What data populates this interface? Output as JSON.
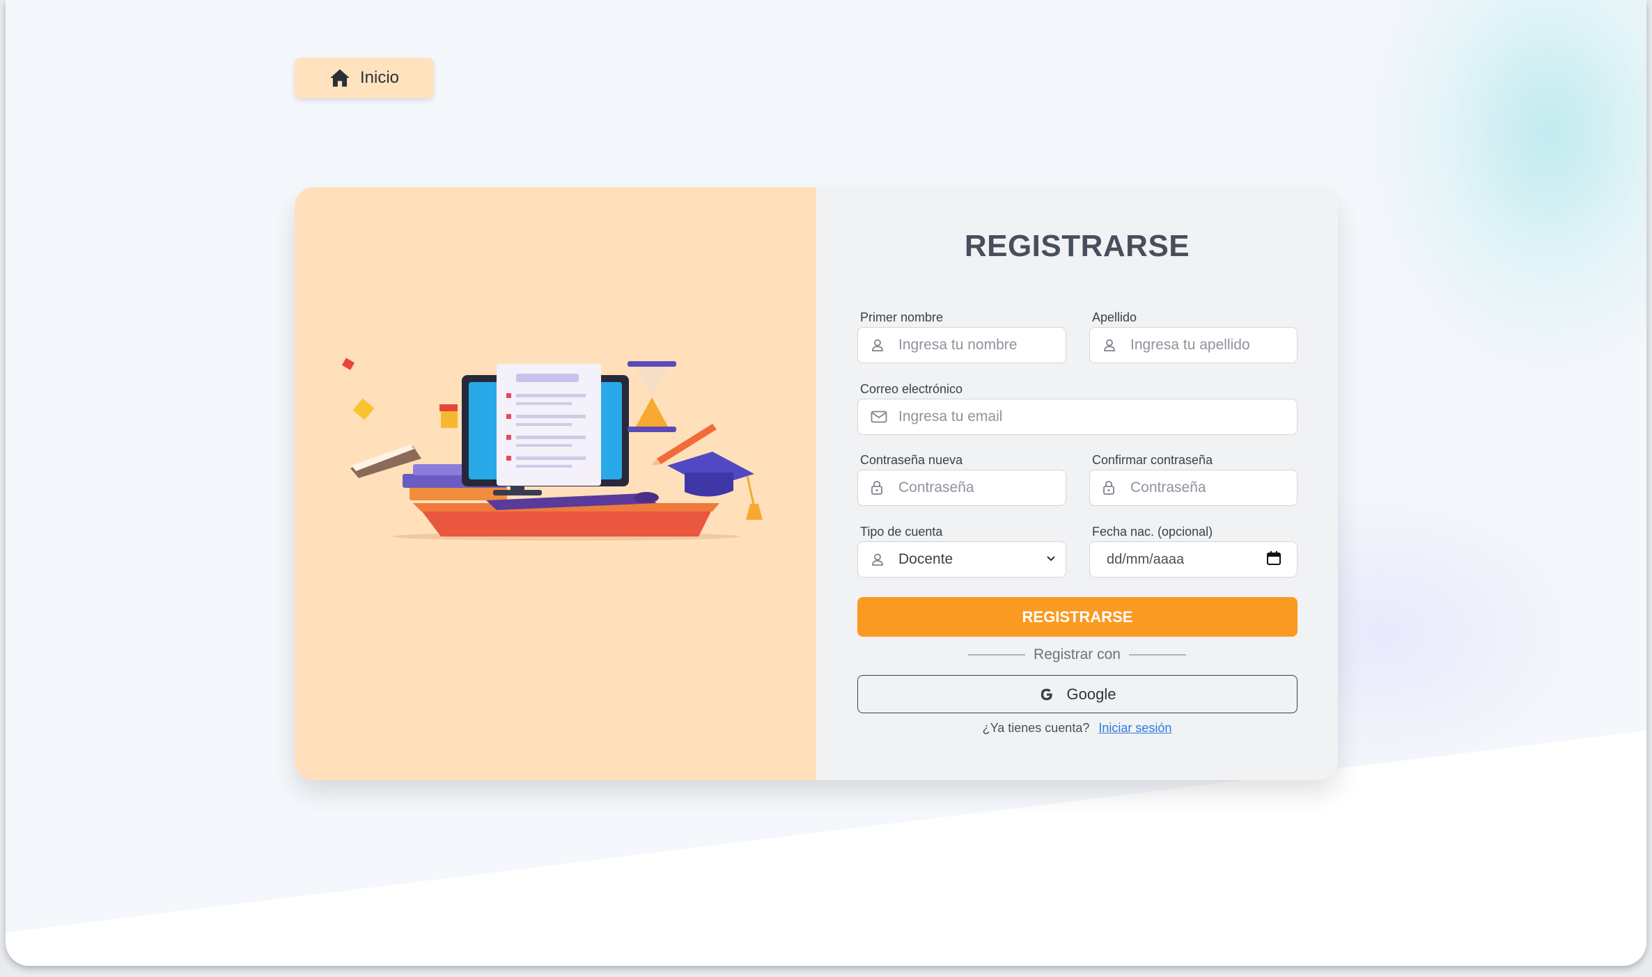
{
  "nav": {
    "home_label": "Inicio"
  },
  "form": {
    "title": "REGISTRARSE",
    "first_name": {
      "label": "Primer nombre",
      "placeholder": "Ingresa tu nombre"
    },
    "last_name": {
      "label": "Apellido",
      "placeholder": "Ingresa tu apellido"
    },
    "email": {
      "label": "Correo electrónico",
      "placeholder": "Ingresa tu email"
    },
    "password": {
      "label": "Contraseña nueva",
      "placeholder": "Contraseña"
    },
    "confirm_password": {
      "label": "Confirmar contraseña",
      "placeholder": "Contraseña"
    },
    "account_type": {
      "label": "Tipo de cuenta",
      "selected": "Docente"
    },
    "birthdate": {
      "label": "Fecha nac. (opcional)",
      "placeholder": "dd/mm/aaaa"
    },
    "submit_label": "REGISTRARSE",
    "divider_text": "Registrar con",
    "google_label": "Google",
    "login_prompt": "¿Ya tienes cuenta?",
    "login_link": "Iniciar sesión"
  },
  "colors": {
    "accent": "#fb9a22",
    "left_panel": "#ffe0bb",
    "link": "#2a7be4"
  },
  "icons": {
    "home": "home-icon",
    "user": "user-icon",
    "mail": "mail-icon",
    "lock": "lock-icon",
    "chevron": "chevron-down-icon",
    "calendar": "calendar-icon",
    "google": "google-icon"
  }
}
